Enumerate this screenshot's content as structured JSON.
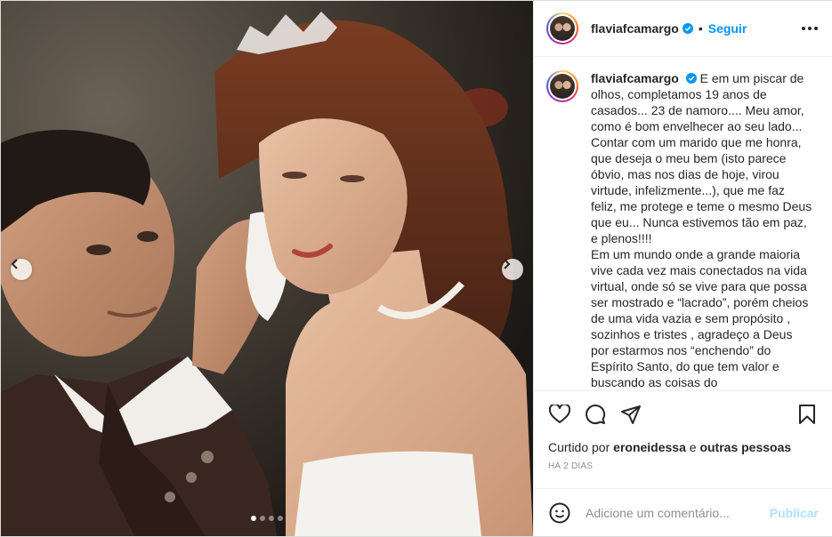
{
  "post": {
    "username": "flaviafcamargo",
    "separator": "•",
    "follow_label": "Seguir",
    "caption_paragraphs": [
      "E em um piscar de olhos, completamos 19 anos de casados... 23 de namoro.... Meu amor, como é bom envelhecer ao seu lado... Contar com um marido que me honra, que deseja o meu bem (isto parece óbvio, mas nos dias de hoje, virou virtude, infelizmente...), que me faz feliz, me protege e teme o mesmo Deus que eu... Nunca estivemos tão em paz, e plenos!!!!",
      "Em um mundo onde a grande maioria vive cada vez mais conectados na vida virtual, onde só se vive para que possa ser mostrado e “lacrado”, porém cheios de uma vida vazia e sem propósito , sozinhos e tristes , agradeço a Deus por estarmos nos “enchendo” do Espírito Santo, do que tem valor e buscando as coisas do"
    ],
    "likes_prefix": "Curtido por",
    "likes_user": "eroneidessa",
    "likes_and": "e",
    "likes_others": "outras pessoas",
    "time_ago": "HÁ 2 DIAS",
    "comment_placeholder": "Adicione um comentário...",
    "publish_label": "Publicar"
  },
  "carousel": {
    "dot_count": 4,
    "active_dot": 0
  },
  "icons": {
    "verified": "verified-badge-icon",
    "more": "more-options-icon",
    "like": "heart-icon",
    "comment": "comment-icon",
    "share": "paper-plane-icon",
    "save": "bookmark-icon",
    "emoji": "emoji-icon",
    "prev": "chevron-left-icon",
    "next": "chevron-right-icon"
  },
  "colors": {
    "accent": "#0095f6",
    "publish_disabled": "#b2dffc",
    "muted": "#8e8e8e",
    "text": "#262626"
  }
}
